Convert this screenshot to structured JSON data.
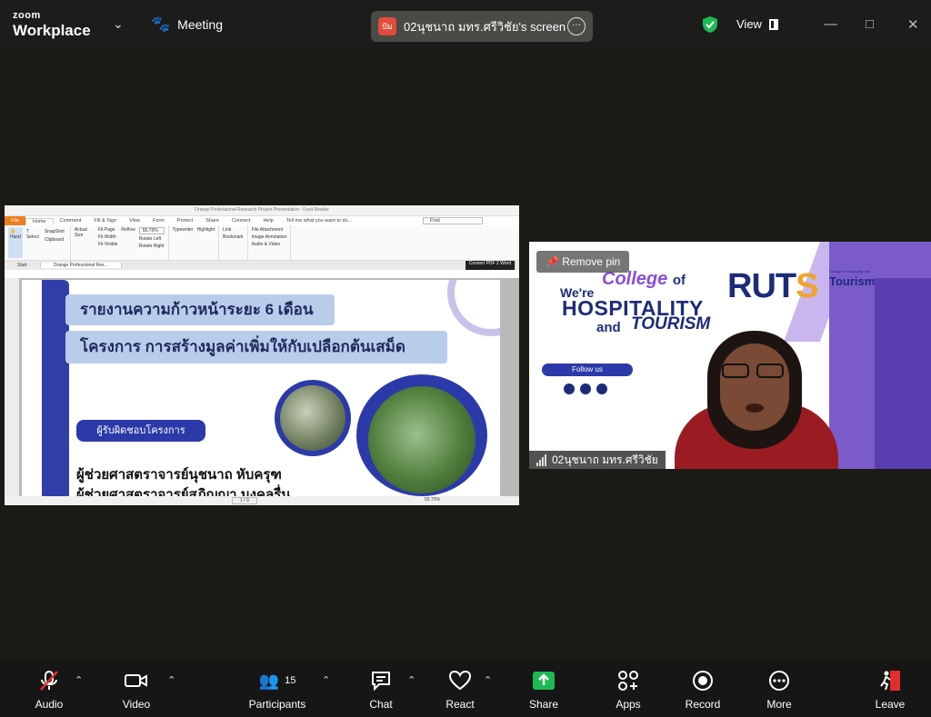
{
  "app": {
    "brand_line1": "zoom",
    "brand_line2": "Workplace",
    "meeting_label": "Meeting"
  },
  "share_pill": {
    "avatar_text": "ปัม",
    "label": "02นุชนาถ มทร.ศรีวิชัย's screen"
  },
  "view_label": "View",
  "shared_screen": {
    "window_title": "Orange Professional Research Project Presentation - Foxit Reader",
    "menu": [
      "File",
      "Home",
      "Comment",
      "Fill & Sign",
      "View",
      "Form",
      "Protect",
      "Share",
      "Connect",
      "Help"
    ],
    "tell_me": "Tell me what you want to do...",
    "search_placeholder": "Find",
    "ribbon": {
      "hand": "Hand",
      "select": "Select",
      "snapshot": "SnapShot",
      "clipboard": "Clipboard",
      "actual_size": "Actual Size",
      "fit_page": "Fit Page",
      "fit_width": "Fit Width",
      "fit_visible": "Fit Visible",
      "reflow": "Reflow",
      "zoom": "55.75%",
      "rotate_left": "Rotate Left",
      "rotate_right": "Rotate Right",
      "typewriter": "Typewriter",
      "highlight": "Highlight",
      "link": "Link",
      "bookmark": "Bookmark",
      "file_attachment": "File Attachment",
      "image_annotation": "Image Annotation",
      "audio_video": "Audio & Video",
      "grp_tools": "Tools",
      "grp_view": "View",
      "grp_comment": "Comment",
      "grp_links": "Links",
      "grp_insert": "Insert"
    },
    "tabs": [
      "Start",
      "Orange Professional Res..."
    ],
    "convert": "Convert PDF 2 Word",
    "slide": {
      "line1": "รายงานความก้าวหน้าระยะ 6 เดือน",
      "line2": "โครงการ การสร้างมูลค่าเพิ่มให้กับเปลือกต้นเสม็ด",
      "responsible": "ผู้รับผิดชอบโครงการ",
      "name1": "ผู้ช่วยศาสตราจารย์นุชนาถ หับครุฑ",
      "name2": "ผู้ช่วยศาสตราจารย์สุภิญญา มงคลรื่น"
    },
    "page_indicator": "1 / 9",
    "zoom_status": "55.75%"
  },
  "video": {
    "remove_pin": "Remove pin",
    "were": "We're",
    "college": "College",
    "of": "of",
    "hospitality": "HOSPITALITY",
    "and": "and",
    "tourism": "TOURISM",
    "follow": "Follow us",
    "ruts_a": "RUT",
    "ruts_b": "S",
    "college_small": "College of Hospitality and",
    "tourism_small": "Tourism",
    "participant_name": "02นุชนาถ มทร.ศรีวิชัย"
  },
  "toolbar": {
    "audio": "Audio",
    "video": "Video",
    "participants": "Participants",
    "participants_count": "15",
    "chat": "Chat",
    "react": "React",
    "share": "Share",
    "apps": "Apps",
    "record": "Record",
    "more": "More",
    "leave": "Leave"
  },
  "colors": {
    "share_green": "#1db954",
    "leave_red": "#e02d2d",
    "slide_blue": "#2b3aa8"
  }
}
